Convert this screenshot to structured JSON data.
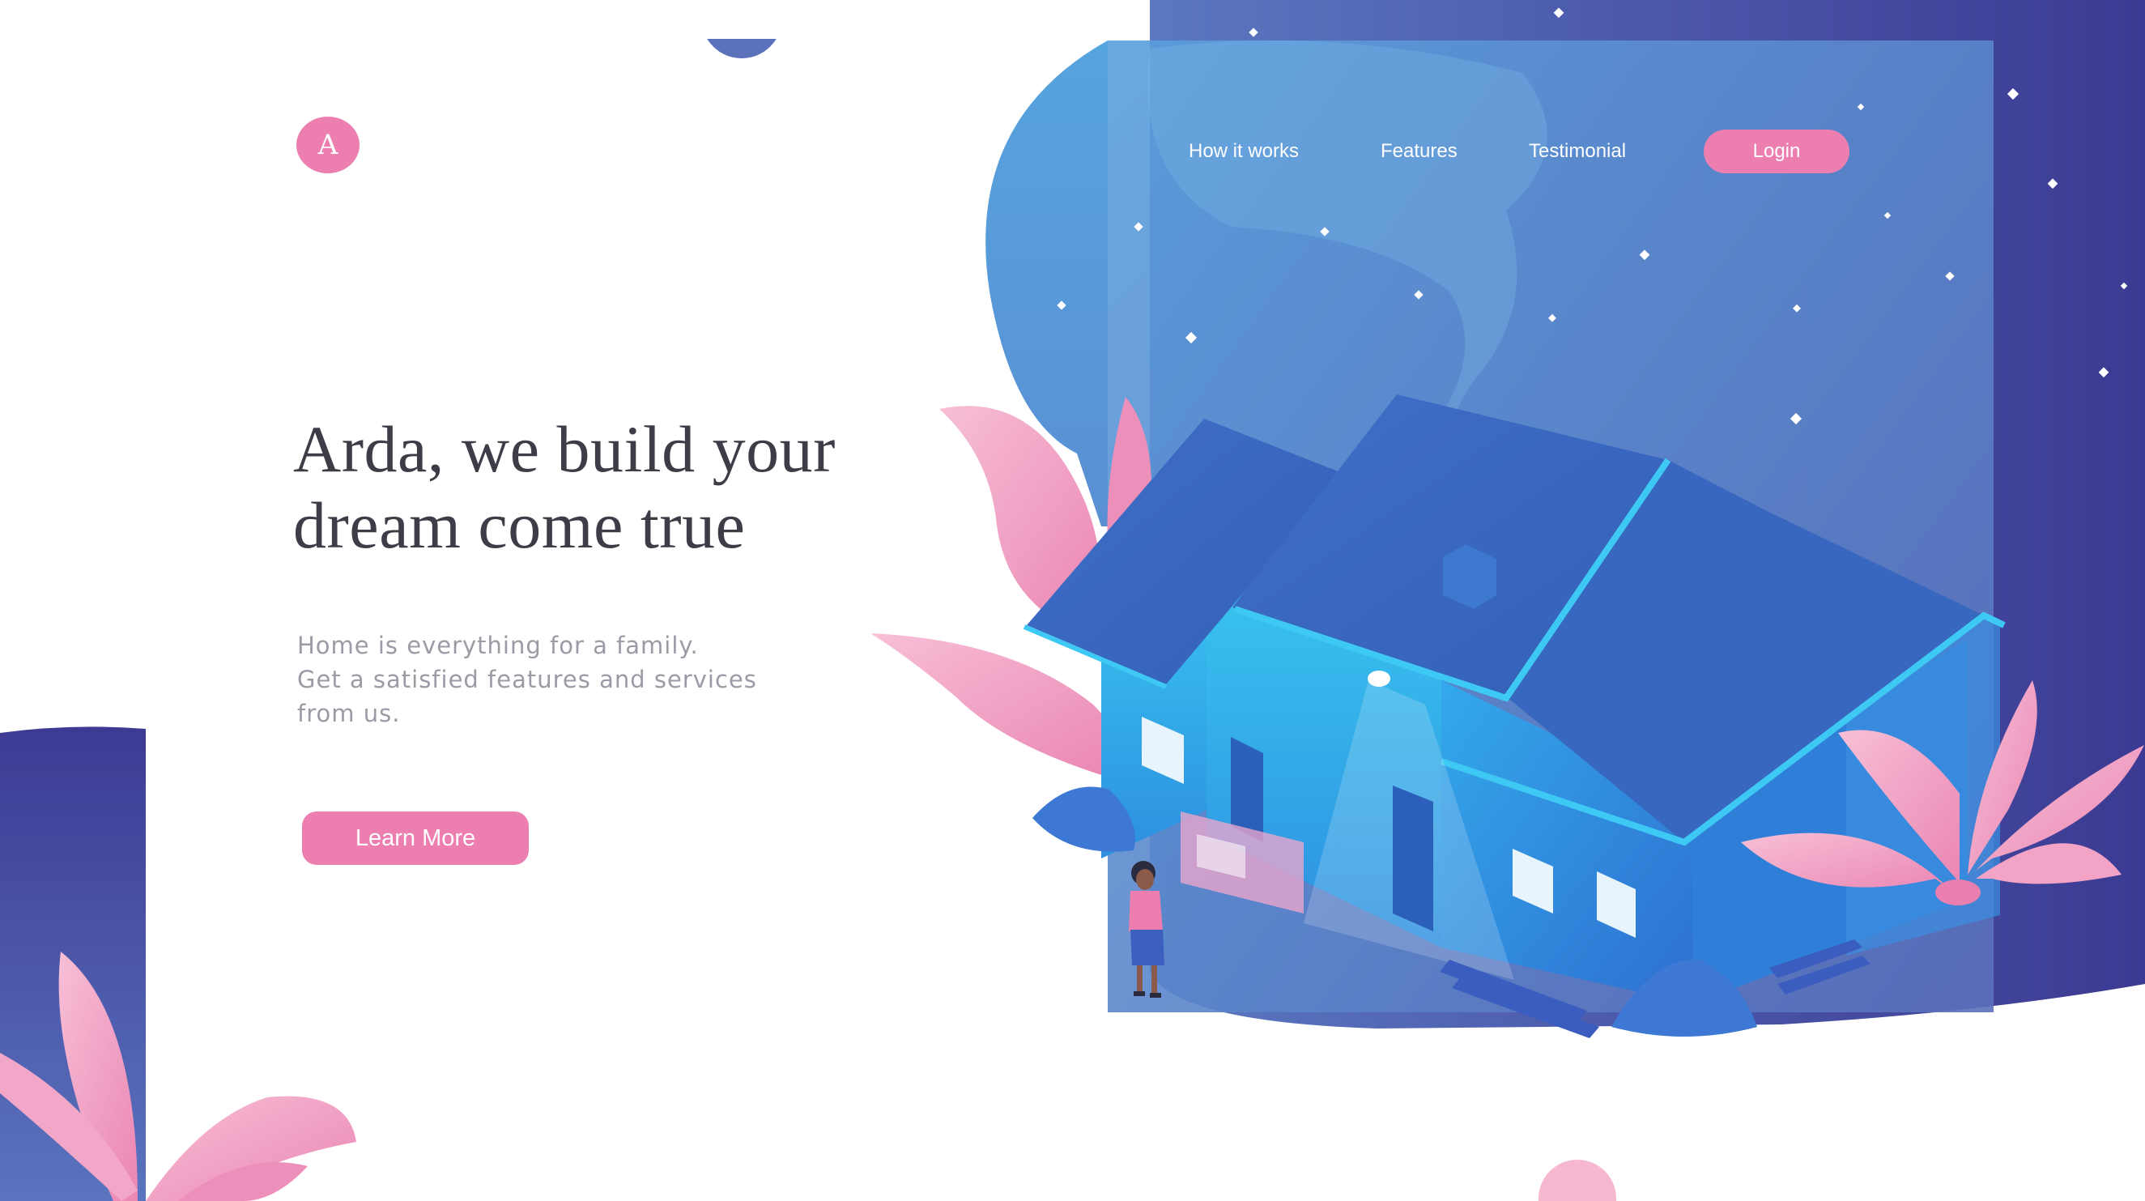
{
  "brand": {
    "logo_letter": "A"
  },
  "nav": {
    "items": [
      {
        "label": "How it works"
      },
      {
        "label": "Features"
      },
      {
        "label": "Testimonial"
      }
    ],
    "login_label": "Login"
  },
  "hero": {
    "title_lines": [
      "Arda, we build your",
      "dream come true"
    ],
    "subtitle_lines": [
      "Home is everything for a family.",
      "Get a satisfied features and services",
      "from us."
    ],
    "cta_label": "Learn More"
  },
  "colors": {
    "accent_pink": "#ec7fb0",
    "deep_indigo": "#3f3d96",
    "sky_blue": "#4fa3df",
    "title_text": "#3d3d47",
    "body_text": "#9b9ba6"
  },
  "illustration": {
    "icons": [
      "house-illustration",
      "woman-figure",
      "pink-plant",
      "star-sparkle"
    ]
  }
}
